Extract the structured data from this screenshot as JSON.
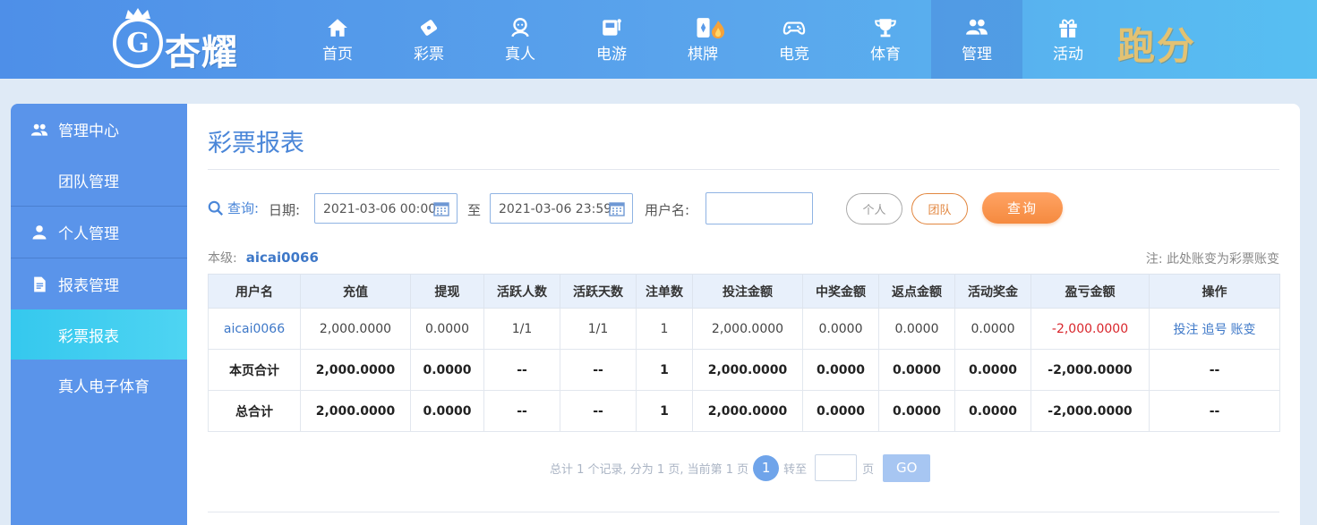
{
  "header": {
    "logo_text": "杏耀",
    "logo_emblem": "G",
    "nav": [
      {
        "label": "首页",
        "icon": "home-icon"
      },
      {
        "label": "彩票",
        "icon": "lottery-ticket-icon"
      },
      {
        "label": "真人",
        "icon": "live-dealer-icon"
      },
      {
        "label": "电游",
        "icon": "slot-machine-icon"
      },
      {
        "label": "棋牌",
        "icon": "card-game-icon"
      },
      {
        "label": "电竞",
        "icon": "gamepad-icon"
      },
      {
        "label": "体育",
        "icon": "trophy-icon"
      },
      {
        "label": "管理",
        "icon": "users-icon"
      },
      {
        "label": "活动",
        "icon": "gift-icon"
      }
    ],
    "active_nav": "管理",
    "extra": "跑分"
  },
  "sidebar": {
    "groups": [
      {
        "label": "管理中心",
        "icon": "users-icon"
      },
      {
        "label": "团队管理"
      },
      {
        "label": "个人管理",
        "icon": "user-icon"
      },
      {
        "label": "报表管理",
        "icon": "report-icon"
      },
      {
        "label": "彩票报表"
      },
      {
        "label": "真人电子体育"
      }
    ],
    "active": "彩票报表"
  },
  "main": {
    "title": "彩票报表",
    "filter": {
      "query_label": "查询:",
      "date_label": "日期:",
      "start_date": "2021-03-06 00:00",
      "to_label": "至",
      "end_date": "2021-03-06 23:59",
      "username_label": "用户名:",
      "username_value": "",
      "btn_personal": "个人",
      "btn_team": "团队",
      "btn_query": "查询"
    },
    "level_label": "本级:",
    "level_user": "aicai0066",
    "note": "注: 此处账变为彩票账变",
    "table": {
      "headers": [
        "用户名",
        "充值",
        "提现",
        "活跃人数",
        "活跃天数",
        "注单数",
        "投注金额",
        "中奖金额",
        "返点金额",
        "活动奖金",
        "盈亏金额",
        "操作"
      ],
      "row": {
        "user": "aicai0066",
        "recharge": "2,000.0000",
        "withdraw": "0.0000",
        "active_users": "1/1",
        "active_days": "1/1",
        "orders": "1",
        "bet": "2,000.0000",
        "win": "0.0000",
        "rebate": "0.0000",
        "bonus": "0.0000",
        "profit": "-2,000.0000",
        "ops": [
          "投注",
          "追号",
          "账变"
        ]
      },
      "page_total": {
        "label": "本页合计",
        "recharge": "2,000.0000",
        "withdraw": "0.0000",
        "active_users": "--",
        "active_days": "--",
        "orders": "1",
        "bet": "2,000.0000",
        "win": "0.0000",
        "rebate": "0.0000",
        "bonus": "0.0000",
        "profit": "-2,000.0000",
        "ops": "--"
      },
      "grand_total": {
        "label": "总合计",
        "recharge": "2,000.0000",
        "withdraw": "0.0000",
        "active_users": "--",
        "active_days": "--",
        "orders": "1",
        "bet": "2,000.0000",
        "win": "0.0000",
        "rebate": "0.0000",
        "bonus": "0.0000",
        "profit": "-2,000.0000",
        "ops": "--"
      }
    },
    "pager": {
      "summary": "总计 1 个记录, 分为 1 页, 当前第 1 页",
      "current": "1",
      "goto_label": "转至",
      "page_unit": "页",
      "go": "GO"
    }
  },
  "colors": {
    "header_start": "#4e8fe8",
    "header_end": "#57bff2",
    "sidebar": "#5a94ea",
    "sidebar_active": "#35c8ee",
    "accent_blue": "#4a86d8",
    "query_orange": "#f58a3f",
    "negative_red": "#d9262c"
  }
}
